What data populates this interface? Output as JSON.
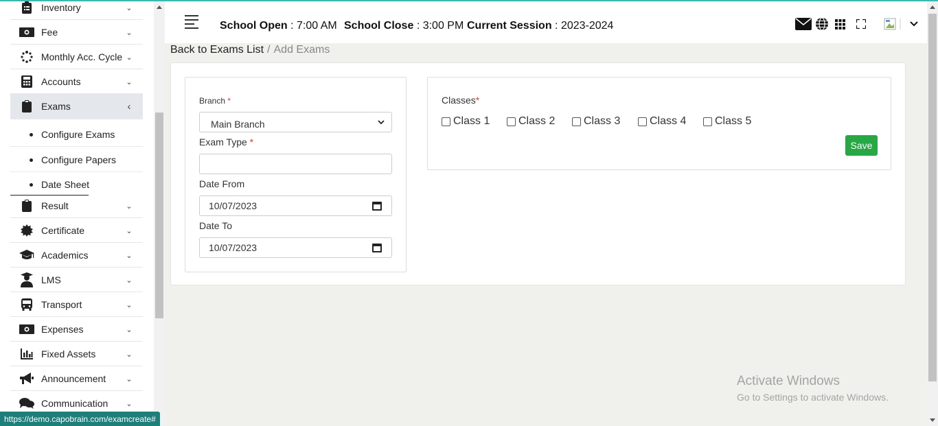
{
  "sidebar": {
    "items": [
      {
        "label": "Inventory",
        "icon": "clipboard-list-icon"
      },
      {
        "label": "Fee",
        "icon": "money-bill-icon"
      },
      {
        "label": "Monthly Acc. Cycle",
        "icon": "spinner-icon"
      },
      {
        "label": "Accounts",
        "icon": "calculator-icon"
      },
      {
        "label": "Exams",
        "icon": "clipboard-icon"
      },
      {
        "label": "Result",
        "icon": "clipboard-icon"
      },
      {
        "label": "Certificate",
        "icon": "certificate-icon"
      },
      {
        "label": "Academics",
        "icon": "graduation-cap-icon"
      },
      {
        "label": "LMS",
        "icon": "user-graduate-icon"
      },
      {
        "label": "Transport",
        "icon": "bus-icon"
      },
      {
        "label": "Expenses",
        "icon": "money-bill-icon"
      },
      {
        "label": "Fixed Assets",
        "icon": "chart-bar-icon"
      },
      {
        "label": "Announcement",
        "icon": "bullhorn-icon"
      },
      {
        "label": "Communication",
        "icon": "comments-icon"
      }
    ],
    "exams_sub": [
      "Configure Exams",
      "Configure Papers",
      "Date Sheet"
    ]
  },
  "header": {
    "school_open_label": "School Open",
    "school_open_value": ": 7:00 AM",
    "school_close_label": "School Close",
    "school_close_value": ": 3:00 PM",
    "session_label": "Current Session",
    "session_value": ": 2023-2024"
  },
  "breadcrumb": {
    "link": "Back to Exams List",
    "separator": "/",
    "current": "Add Exams"
  },
  "form": {
    "branch_label": "Branch",
    "branch_value": "Main Branch",
    "exam_type_label": "Exam Type",
    "exam_type_value": "",
    "date_from_label": "Date From",
    "date_from_value": "10/07/2023",
    "date_to_label": "Date To",
    "date_to_value": "10/07/2023",
    "required_mark": "*"
  },
  "classes": {
    "label": "Classes",
    "items": [
      "Class 1",
      "Class 2",
      "Class 3",
      "Class 4",
      "Class 5"
    ],
    "save_label": "Save"
  },
  "watermark": {
    "line1": "Activate Windows",
    "line2": "Go to Settings to activate Windows."
  },
  "status_url": "https://demo.capobrain.com/examcreate#",
  "colors": {
    "accent_teal": "#3ab9b1",
    "save_green": "#28a745",
    "required_red": "#e23b3b"
  }
}
